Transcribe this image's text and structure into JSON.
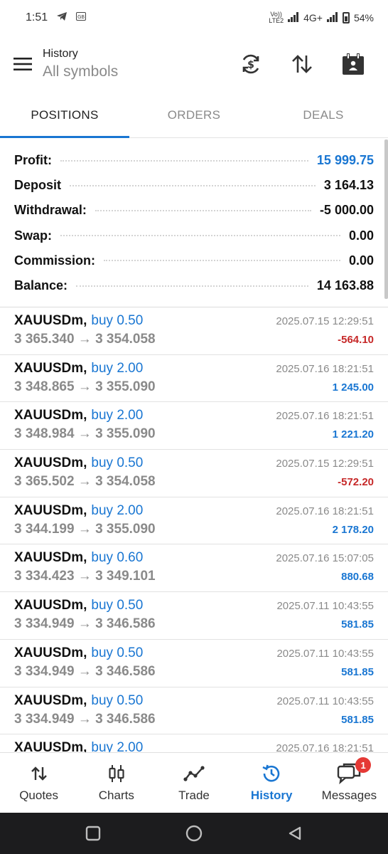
{
  "status_bar": {
    "time": "1:51",
    "network_top": "Vo))",
    "network_bottom": "LTE2",
    "signal_label": "4G+",
    "battery": "54%"
  },
  "header": {
    "title": "History",
    "subtitle": "All symbols"
  },
  "tabs": [
    {
      "label": "POSITIONS",
      "active": true
    },
    {
      "label": "ORDERS",
      "active": false
    },
    {
      "label": "DEALS",
      "active": false
    }
  ],
  "summary": {
    "profit": {
      "label": "Profit:",
      "value": "15 999.75"
    },
    "deposit": {
      "label": "Deposit",
      "value": "3 164.13"
    },
    "withdrawal": {
      "label": "Withdrawal:",
      "value": "-5 000.00"
    },
    "swap": {
      "label": "Swap:",
      "value": "0.00"
    },
    "commission": {
      "label": "Commission:",
      "value": "0.00"
    },
    "balance": {
      "label": "Balance:",
      "value": "14 163.88"
    }
  },
  "trades": [
    {
      "symbol": "XAUUSDm,",
      "side": "buy 0.50",
      "time": "2025.07.15 12:29:51",
      "prices": "3 365.340 → 3 354.058",
      "profit": "-564.10",
      "profit_sign": "neg"
    },
    {
      "symbol": "XAUUSDm,",
      "side": "buy 2.00",
      "time": "2025.07.16 18:21:51",
      "prices": "3 348.865 → 3 355.090",
      "profit": "1 245.00",
      "profit_sign": "pos"
    },
    {
      "symbol": "XAUUSDm,",
      "side": "buy 2.00",
      "time": "2025.07.16 18:21:51",
      "prices": "3 348.984 → 3 355.090",
      "profit": "1 221.20",
      "profit_sign": "pos"
    },
    {
      "symbol": "XAUUSDm,",
      "side": "buy 0.50",
      "time": "2025.07.15 12:29:51",
      "prices": "3 365.502 → 3 354.058",
      "profit": "-572.20",
      "profit_sign": "neg"
    },
    {
      "symbol": "XAUUSDm,",
      "side": "buy 2.00",
      "time": "2025.07.16 18:21:51",
      "prices": "3 344.199 → 3 355.090",
      "profit": "2 178.20",
      "profit_sign": "pos"
    },
    {
      "symbol": "XAUUSDm,",
      "side": "buy 0.60",
      "time": "2025.07.16 15:07:05",
      "prices": "3 334.423 → 3 349.101",
      "profit": "880.68",
      "profit_sign": "pos"
    },
    {
      "symbol": "XAUUSDm,",
      "side": "buy 0.50",
      "time": "2025.07.11 10:43:55",
      "prices": "3 334.949 → 3 346.586",
      "profit": "581.85",
      "profit_sign": "pos"
    },
    {
      "symbol": "XAUUSDm,",
      "side": "buy 0.50",
      "time": "2025.07.11 10:43:55",
      "prices": "3 334.949 → 3 346.586",
      "profit": "581.85",
      "profit_sign": "pos"
    },
    {
      "symbol": "XAUUSDm,",
      "side": "buy 0.50",
      "time": "2025.07.11 10:43:55",
      "prices": "3 334.949 → 3 346.586",
      "profit": "581.85",
      "profit_sign": "pos"
    },
    {
      "symbol": "XAUUSDm,",
      "side": "buy 2.00",
      "time": "2025.07.16 18:21:51",
      "prices": "",
      "profit": "",
      "profit_sign": "pos"
    }
  ],
  "bottom_nav": [
    {
      "label": "Quotes",
      "icon": "quotes-icon",
      "active": false
    },
    {
      "label": "Charts",
      "icon": "charts-icon",
      "active": false
    },
    {
      "label": "Trade",
      "icon": "trade-icon",
      "active": false
    },
    {
      "label": "History",
      "icon": "history-icon",
      "active": true
    },
    {
      "label": "Messages",
      "icon": "messages-icon",
      "active": false,
      "badge": "1"
    }
  ],
  "colors": {
    "accent": "#1976d2",
    "loss": "#c62828",
    "badge": "#e53935"
  }
}
